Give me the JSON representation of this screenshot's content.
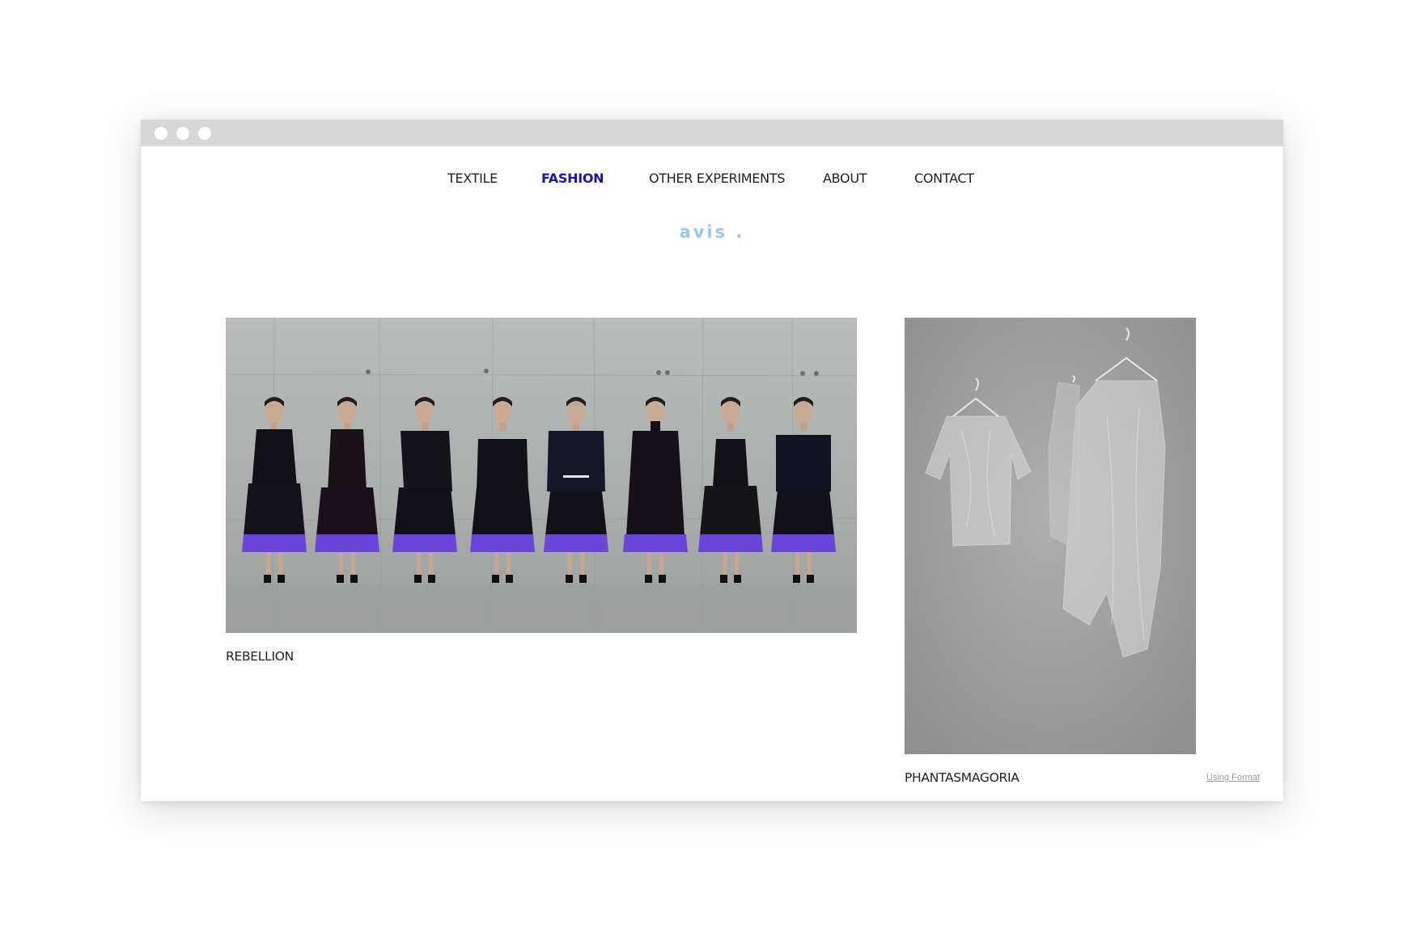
{
  "nav": {
    "items": [
      {
        "label": "TEXTILE",
        "active": false
      },
      {
        "label": "FASHION",
        "active": true
      },
      {
        "label": "OTHER EXPERIMENTS",
        "active": false
      },
      {
        "label": "ABOUT",
        "active": false
      },
      {
        "label": "CONTACT",
        "active": false
      }
    ],
    "active_color": "#1a17a8"
  },
  "logo": "avis .",
  "logo_color": "#9cc6ea",
  "projects": [
    {
      "title": "REBELLION"
    },
    {
      "title": "PHANTASMAGORIA"
    }
  ],
  "footer": {
    "credit": "Using Format"
  },
  "colors": {
    "skirt_accent": "#6a45d8",
    "titlebar": "#d7d7d7"
  }
}
